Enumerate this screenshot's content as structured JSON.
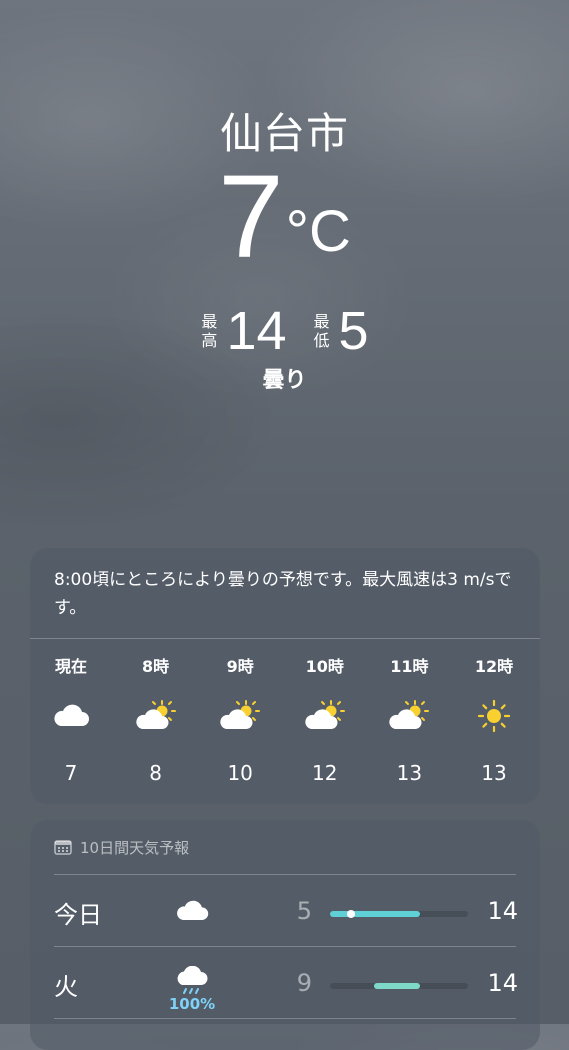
{
  "header": {
    "city": "仙台市",
    "temperature": "7",
    "unit": "°C",
    "high_label": "最高",
    "high": "14",
    "low_label": "最低",
    "low": "5",
    "condition": "曇り"
  },
  "hourly": {
    "summary": "8:00頃にところにより曇りの予想です。最大風速は3 m/sです。",
    "items": [
      {
        "time": "現在",
        "icon": "cloud-icon",
        "temp": "7"
      },
      {
        "time": "8時",
        "icon": "sun-cloud-icon",
        "temp": "8"
      },
      {
        "time": "9時",
        "icon": "sun-cloud-icon",
        "temp": "10"
      },
      {
        "time": "10時",
        "icon": "sun-cloud-icon",
        "temp": "12"
      },
      {
        "time": "11時",
        "icon": "sun-cloud-icon",
        "temp": "13"
      },
      {
        "time": "12時",
        "icon": "sun-icon",
        "temp": "13"
      }
    ]
  },
  "daily": {
    "title": "10日間天気予報",
    "rows": [
      {
        "day": "今日",
        "icon": "cloud-icon",
        "precip": "",
        "low": "5",
        "high": "14",
        "bar_start": 0.0,
        "bar_end": 0.65,
        "current_dot": 0.15,
        "bar_color": "#5fd0d6"
      },
      {
        "day": "火",
        "icon": "rain-cloud-icon",
        "precip": "100%",
        "low": "9",
        "high": "14",
        "bar_start": 0.32,
        "bar_end": 0.65,
        "current_dot": null,
        "bar_color": "#7fd9c8"
      }
    ]
  },
  "colors": {
    "accent_rain": "#7fd1f7",
    "sun": "#f8d030"
  }
}
